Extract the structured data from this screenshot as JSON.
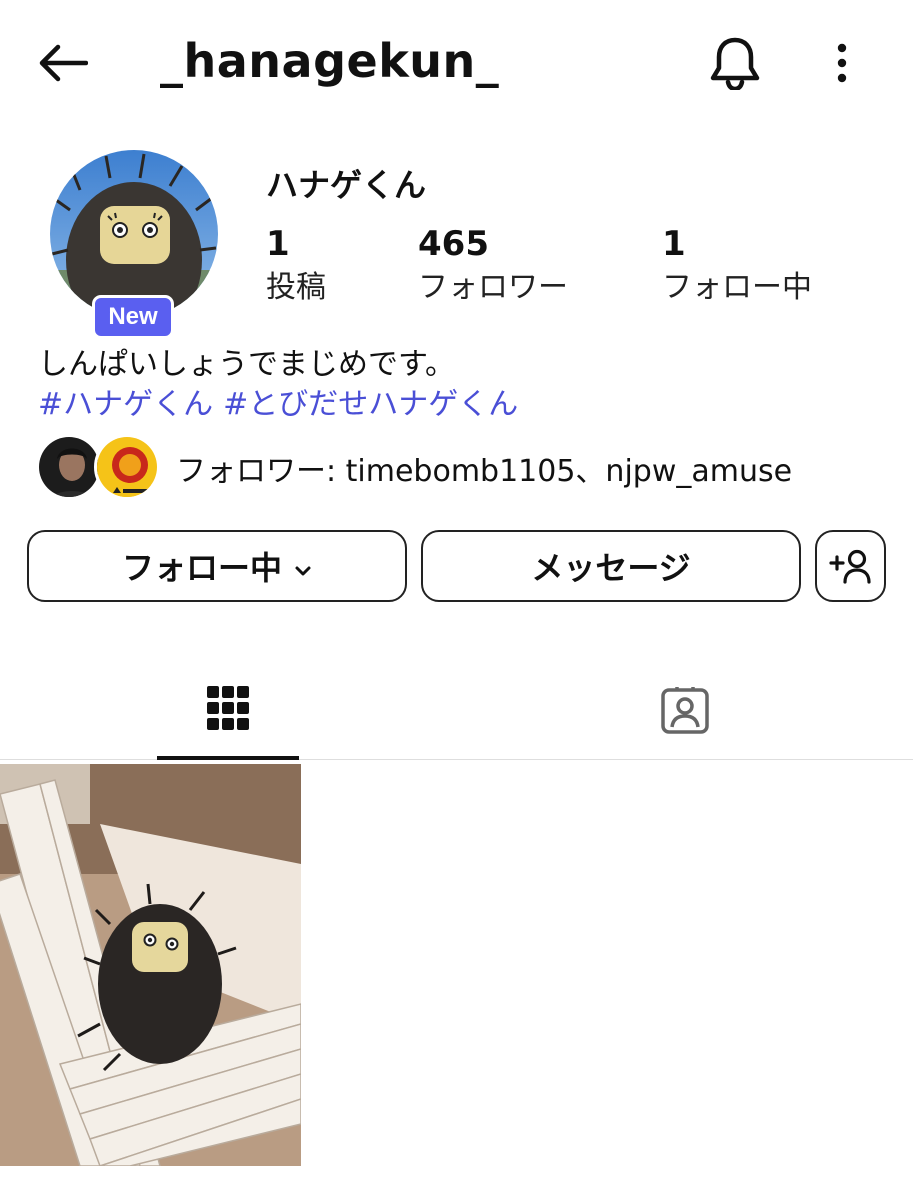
{
  "header": {
    "username": "_hanagekun_",
    "icons": [
      "back-arrow-icon",
      "bell-icon",
      "more-vertical-icon"
    ]
  },
  "profile": {
    "display_name": "ハナゲくん",
    "badge": "New",
    "stats": [
      {
        "value": "1",
        "label": "投稿"
      },
      {
        "value": "465",
        "label": "フォロワー"
      },
      {
        "value": "1",
        "label": "フォロー中"
      }
    ],
    "bio": "しんぱいしょうでまじめです。",
    "hashtags": [
      "#ハナゲくん",
      "#とびだせハナゲくん"
    ],
    "followed_by": "フォロワー: timebomb1105、njpw_amuse"
  },
  "actions": {
    "following_label": "フォロー中",
    "message_label": "メッセージ",
    "add_icon": "add-person-icon"
  },
  "tabs": [
    {
      "name": "posts-grid",
      "icon": "grid-icon",
      "active": true
    },
    {
      "name": "tagged",
      "icon": "tagged-person-icon",
      "active": false
    }
  ],
  "colors": {
    "accent": "#5a5ff0",
    "hashtag": "#4a4fd6",
    "text": "#111111"
  }
}
